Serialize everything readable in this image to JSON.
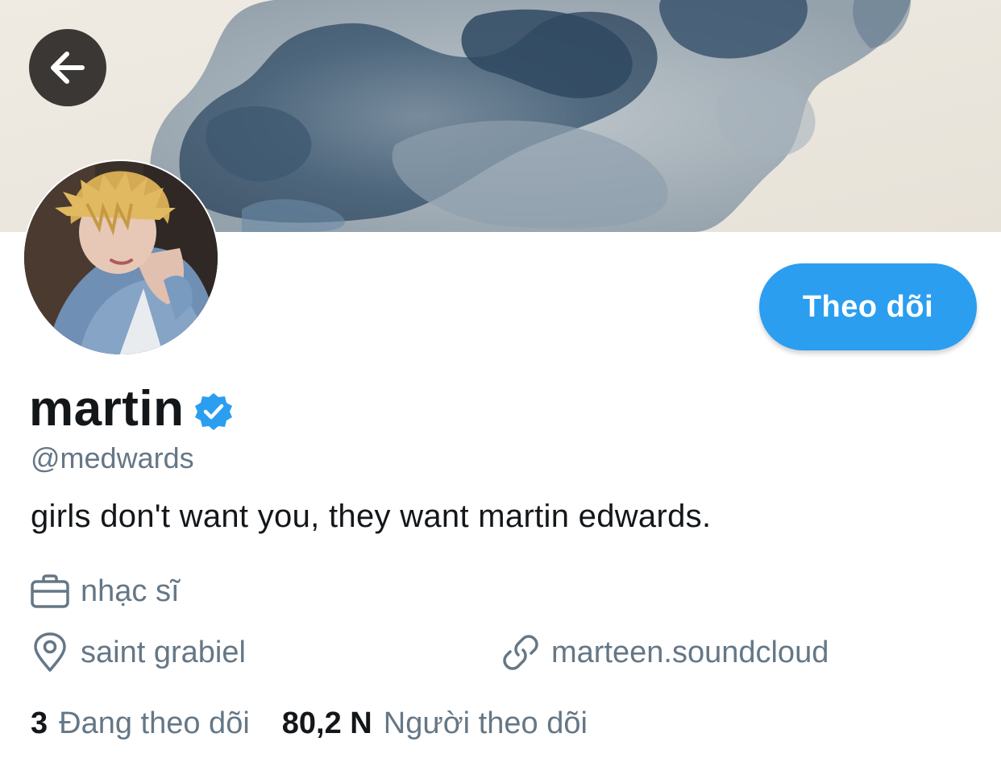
{
  "profile": {
    "display_name": "martin",
    "handle": "@medwards",
    "bio": "girls don't want you, they want martin edwards.",
    "job": "nhạc sĩ",
    "location": "saint grabiel",
    "link": "marteen.soundcloud",
    "verified": true
  },
  "actions": {
    "follow_label": "Theo dõi",
    "back_icon": "arrow-left-icon"
  },
  "stats": {
    "following_count": "3",
    "following_label": "Đang theo dõi",
    "followers_count": "80,2 N",
    "followers_label": "Người theo dõi"
  },
  "icons": {
    "job": "briefcase-icon",
    "location": "map-pin-icon",
    "link": "link-icon",
    "verified": "verified-badge-icon"
  },
  "colors": {
    "accent": "#2b9ef0",
    "text_primary": "#14171a",
    "text_secondary": "#657786"
  }
}
